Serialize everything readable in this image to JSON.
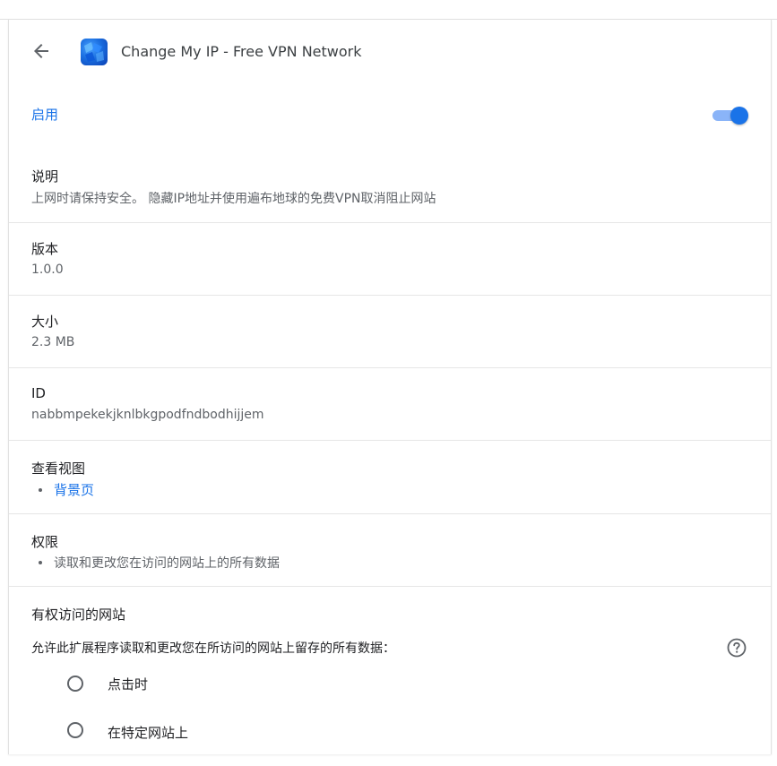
{
  "header": {
    "title": "Change My IP - Free VPN Network",
    "back_icon": "arrow-left-icon",
    "extension_icon": "vpn-logo-icon"
  },
  "enable": {
    "label": "启用",
    "toggle_on": true
  },
  "description": {
    "title": "说明",
    "value": "上网时请保持安全。 隐藏IP地址并使用遍布地球的免费VPN取消阻止网站"
  },
  "version": {
    "title": "版本",
    "value": "1.0.0"
  },
  "size": {
    "title": "大小",
    "value": "2.3 MB"
  },
  "id": {
    "title": "ID",
    "value": "nabbmpekekjknlbkgpodfndbodhijjem"
  },
  "inspect_views": {
    "title": "查看视图",
    "items": [
      "背景页"
    ]
  },
  "permissions": {
    "title": "权限",
    "items": [
      "读取和更改您在访问的网站上的所有数据"
    ]
  },
  "site_access": {
    "title": "有权访问的网站",
    "prompt": "允许此扩展程序读取和更改您在所访问的网站上留存的所有数据：",
    "help_icon": "help-circle-icon",
    "options": [
      "点击时",
      "在特定网站上"
    ]
  },
  "colors": {
    "accent": "#1a73e8",
    "toggle_track": "#8ab4f8",
    "text_secondary": "#5f6368"
  }
}
